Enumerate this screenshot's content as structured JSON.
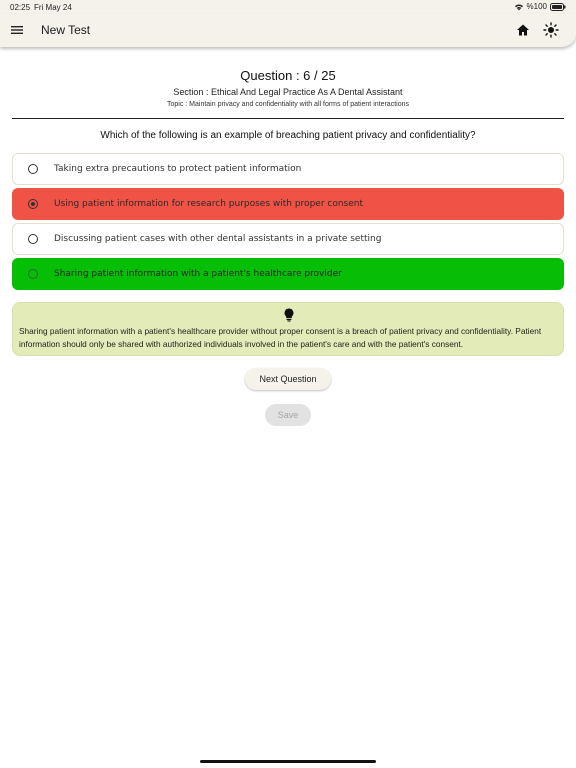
{
  "status_bar": {
    "time": "02:25",
    "date": "Fri May 24",
    "battery": "%100"
  },
  "app_bar": {
    "title": "New Test"
  },
  "quiz": {
    "question_number": "Question : 6 / 25",
    "section": "Section : Ethical And Legal Practice As A Dental Assistant",
    "topic": "Topic : Maintain privacy and confidentiality with all forms of patient interactions",
    "question": "Which of the following is an example of breaching patient privacy and confidentiality?",
    "options": [
      {
        "label": "Taking extra precautions to protect patient information",
        "state": "none"
      },
      {
        "label": "Using patient information for research purposes with proper consent",
        "state": "selected-wrong"
      },
      {
        "label": "Discussing patient cases with other dental assistants in a private setting",
        "state": "none"
      },
      {
        "label": "Sharing patient information with a patient's healthcare provider",
        "state": "correct"
      }
    ],
    "explanation": "Sharing patient information with a patient's healthcare provider without proper consent is a breach of patient privacy and confidentiality. Patient information should only be shared with authorized individuals involved in the patient's care and with the patient's consent."
  },
  "buttons": {
    "next": "Next Question",
    "save": "Save"
  },
  "colors": {
    "wrong": "#f05246",
    "correct": "#05be05",
    "explanation_bg": "#e3ecb8",
    "app_bar": "#f5f2ec"
  }
}
